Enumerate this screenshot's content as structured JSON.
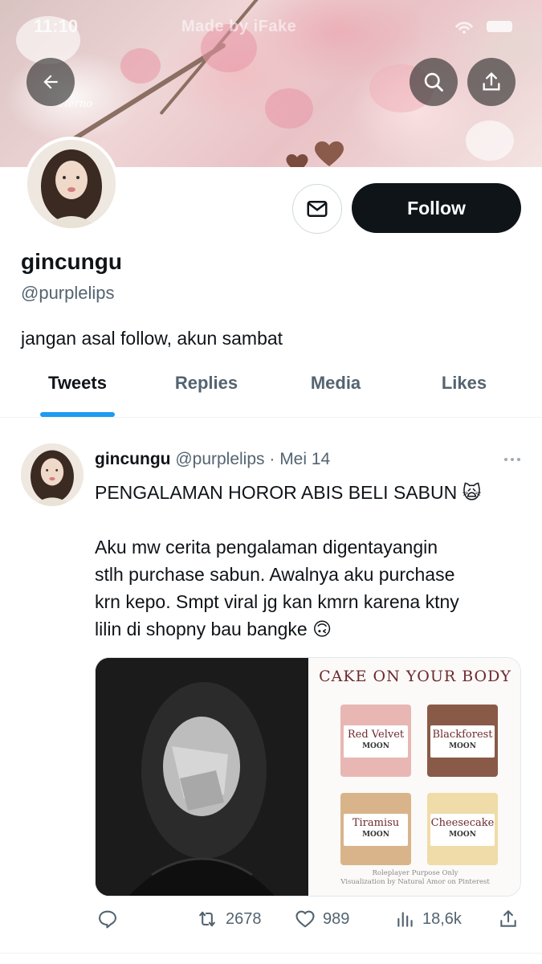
{
  "status_bar": {
    "time": "11:10",
    "center_text": "Made by iFake"
  },
  "banner": {
    "watermark": "eterno"
  },
  "top_nav": {
    "back_icon": "arrow-left-icon",
    "search_icon": "search-icon",
    "share_icon": "share-icon"
  },
  "profile": {
    "display_name": "gincungu",
    "handle": "@purplelips",
    "bio": "jangan asal follow, akun sambat",
    "follow_label": "Follow",
    "dm_icon": "envelope-icon"
  },
  "tabs": [
    {
      "label": "Tweets",
      "active": true
    },
    {
      "label": "Replies",
      "active": false
    },
    {
      "label": "Media",
      "active": false
    },
    {
      "label": "Likes",
      "active": false
    }
  ],
  "tweet": {
    "name": "gincungu",
    "handle_date": "@purplelips · Mei 14",
    "line1": "PENGALAMAN HOROR ABIS BELI SABUN 🙀",
    "line2": "Aku mw cerita pengalaman digentayangin",
    "line3": "stlh purchase sabun. Awalnya aku purchase",
    "line4": "krn kepo. Smpt viral jg kan kmrn karena ktny",
    "line5": "lilin di shopny bau bangke 🙃",
    "media_right": {
      "title": "CAKE ON YOUR BODY",
      "soaps": [
        "Red Velvet",
        "Blackforest",
        "Tiramisu",
        "Cheesecake"
      ],
      "logo": "MOON",
      "footer_1": "Roleplayer Purpose Only",
      "footer_2": "Visualization by Natural Amor on Pinterest"
    },
    "actions": {
      "retweets": "2678",
      "likes": "989",
      "views": "18,6k"
    }
  },
  "colors": {
    "accent": "#1d9bf0",
    "text": "#0f1419",
    "muted": "#536471",
    "follow_bg": "#0f1419"
  }
}
